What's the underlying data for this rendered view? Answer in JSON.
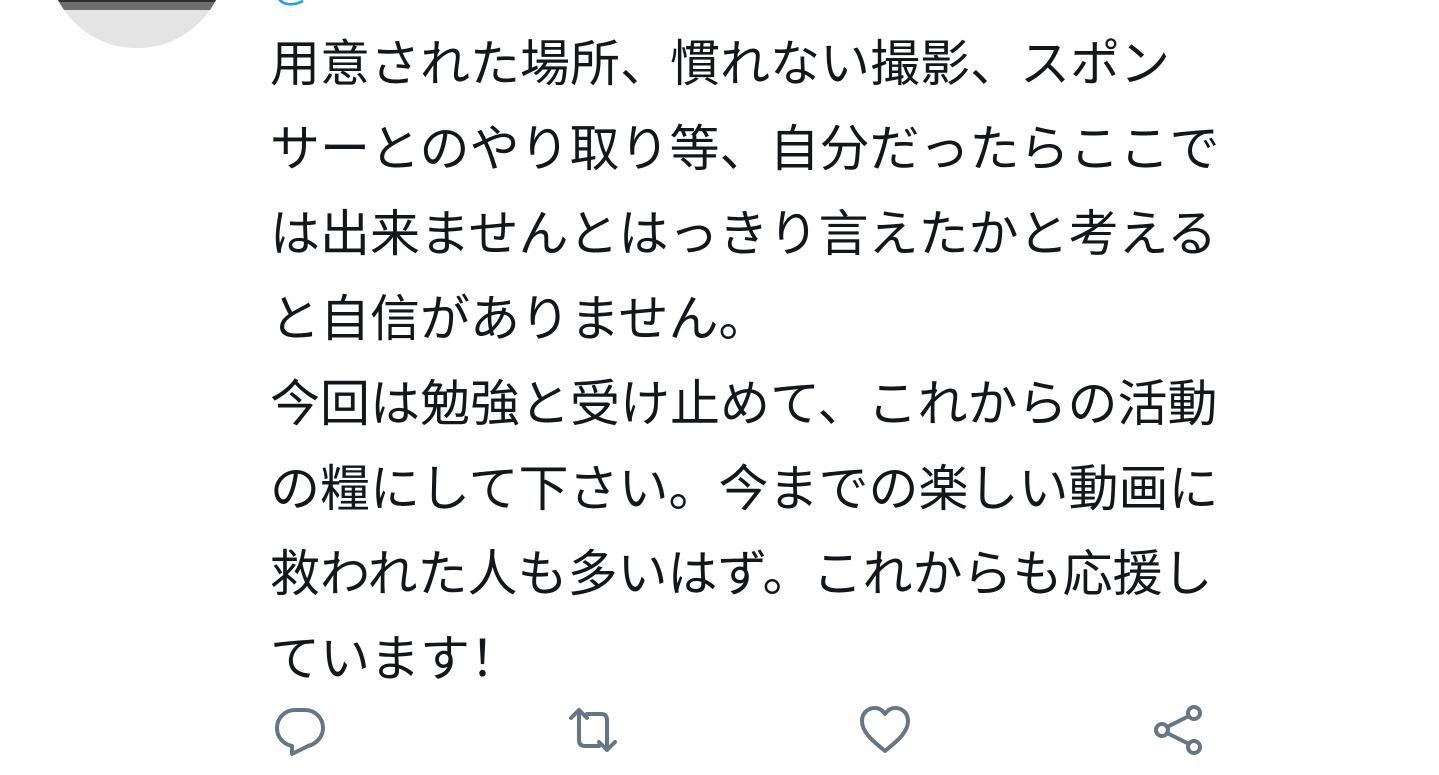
{
  "header": {
    "handle": "@"
  },
  "tweet": {
    "lines": [
      "用意された場所、慣れない撮影、スポン",
      "サーとのやり取り等、自分だったらここで",
      "は出来ませんとはっきり言えたかと考える",
      "と自信がありません。",
      "今回は勉強と受け止めて、これからの活動",
      "の糧にして下さい。今までの楽しい動画に",
      "救われた人も多いはず。これからも応援し",
      "ています！"
    ]
  },
  "actions": {
    "reply_icon": "reply-icon",
    "retweet_icon": "retweet-icon",
    "like_icon": "heart-icon",
    "share_icon": "share-icon",
    "icon_color": "#657786"
  },
  "colors": {
    "text": "#14171a",
    "link": "#1da1f2",
    "background": "#ffffff"
  }
}
